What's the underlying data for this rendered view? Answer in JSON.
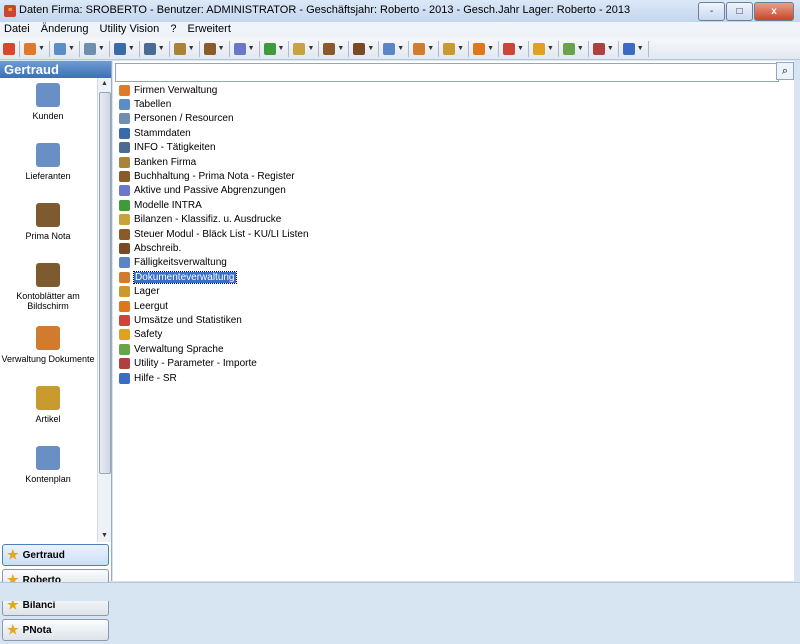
{
  "window": {
    "title": "Daten Firma: SROBERTO - Benutzer: ADMINISTRATOR - Geschäftsjahr: Roberto - 2013 - Gesch.Jahr Lager: Roberto - 2013",
    "controls": {
      "minimize": "-",
      "maximize": "□",
      "close": "x"
    }
  },
  "menu": [
    "Datei",
    "Änderung",
    "Utility Vision",
    "?",
    "Erweitert"
  ],
  "toolbar": {
    "icons": [
      {
        "name": "exit-icon",
        "color": "#d9462b"
      },
      {
        "name": "home-icon",
        "color": "#e07a2a"
      },
      {
        "name": "table-icon",
        "color": "#5b8ec6"
      },
      {
        "name": "persons-icon",
        "color": "#6f8fb0"
      },
      {
        "name": "master-data-icon",
        "color": "#3a6aa8"
      },
      {
        "name": "info-icon",
        "color": "#4a6b94"
      },
      {
        "name": "bank-icon",
        "color": "#a98438"
      },
      {
        "name": "accounting-icon",
        "color": "#8a5a2b"
      },
      {
        "name": "accruals-icon",
        "color": "#6b78c9"
      },
      {
        "name": "models-icon",
        "color": "#3e9a3a"
      },
      {
        "name": "balance-icon",
        "color": "#c7a33b"
      },
      {
        "name": "tax-icon",
        "color": "#8a5a2b"
      },
      {
        "name": "depreciation-icon",
        "color": "#7a4a26"
      },
      {
        "name": "due-icon",
        "color": "#5a86c5"
      },
      {
        "name": "documents-icon",
        "color": "#d07b30"
      },
      {
        "name": "warehouse-icon",
        "color": "#c99a2e"
      },
      {
        "name": "bottle-icon",
        "color": "#e0761a"
      },
      {
        "name": "stats-icon",
        "color": "#c9473a"
      },
      {
        "name": "safety-icon",
        "color": "#e0a21c"
      },
      {
        "name": "language-icon",
        "color": "#6aa34a"
      },
      {
        "name": "utility-icon",
        "color": "#b04040"
      },
      {
        "name": "help-icon",
        "color": "#3b6cc4"
      }
    ],
    "dropdown_glyph": "▼"
  },
  "sidebar": {
    "header": "Gertraud",
    "shortcuts": [
      {
        "label": "Kunden",
        "icon": "customers-icon",
        "color": "#6a8fc4"
      },
      {
        "label": "Lieferanten",
        "icon": "suppliers-icon",
        "color": "#6a8fc4"
      },
      {
        "label": "Prima Nota",
        "icon": "prima-nota-icon",
        "color": "#7d5a2f"
      },
      {
        "label": "Kontoblätter am Bildschirm",
        "icon": "account-sheets-icon",
        "color": "#7d5a2f"
      },
      {
        "label": "Verwaltung Dokumente",
        "icon": "documents-icon",
        "color": "#d07b30"
      },
      {
        "label": "Artikel",
        "icon": "article-icon",
        "color": "#c99a2e"
      },
      {
        "label": "Kontenplan",
        "icon": "chart-of-accounts-icon",
        "color": "#6a8fc4"
      }
    ],
    "groups": [
      "Gertraud",
      "Roberto",
      "Bilanci",
      "PNota"
    ]
  },
  "search": {
    "placeholder": "",
    "button": "⌕"
  },
  "tree": [
    {
      "label": "Firmen Verwaltung",
      "color": "#e07a2a"
    },
    {
      "label": "Tabellen",
      "color": "#5b8ec6"
    },
    {
      "label": "Personen / Resourcen",
      "color": "#6f8fb0"
    },
    {
      "label": "Stammdaten",
      "color": "#3a6aa8"
    },
    {
      "label": "INFO  -  Tätigkeiten",
      "color": "#4a6b94"
    },
    {
      "label": "Banken Firma",
      "color": "#a98438"
    },
    {
      "label": "Buchhaltung - Prima Nota - Register",
      "color": "#8a5a2b"
    },
    {
      "label": "Aktive und Passive Abgrenzungen",
      "color": "#6b78c9"
    },
    {
      "label": "Modelle INTRA",
      "color": "#3e9a3a"
    },
    {
      "label": "Bilanzen - Klassifiz. u. Ausdrucke",
      "color": "#c7a33b"
    },
    {
      "label": "Steuer Modul - Bläck List  -  KU/LI Listen",
      "color": "#8a5a2b"
    },
    {
      "label": "Abschreib.",
      "color": "#7a4a26"
    },
    {
      "label": "Fälligkeitsverwaltung",
      "color": "#5a86c5"
    },
    {
      "label": "Dokumenteverwaltung",
      "color": "#d07b30",
      "selected": true
    },
    {
      "label": "Lager",
      "color": "#c99a2e"
    },
    {
      "label": "Leergut",
      "color": "#e0761a"
    },
    {
      "label": "Umsätze und Statistiken",
      "color": "#c9473a"
    },
    {
      "label": "Safety",
      "color": "#e0a21c"
    },
    {
      "label": "Verwaltung Sprache",
      "color": "#6aa34a"
    },
    {
      "label": "Utility  - Parameter - Importe",
      "color": "#b04040"
    },
    {
      "label": "Hilfe - SR",
      "color": "#3b6cc4"
    }
  ]
}
